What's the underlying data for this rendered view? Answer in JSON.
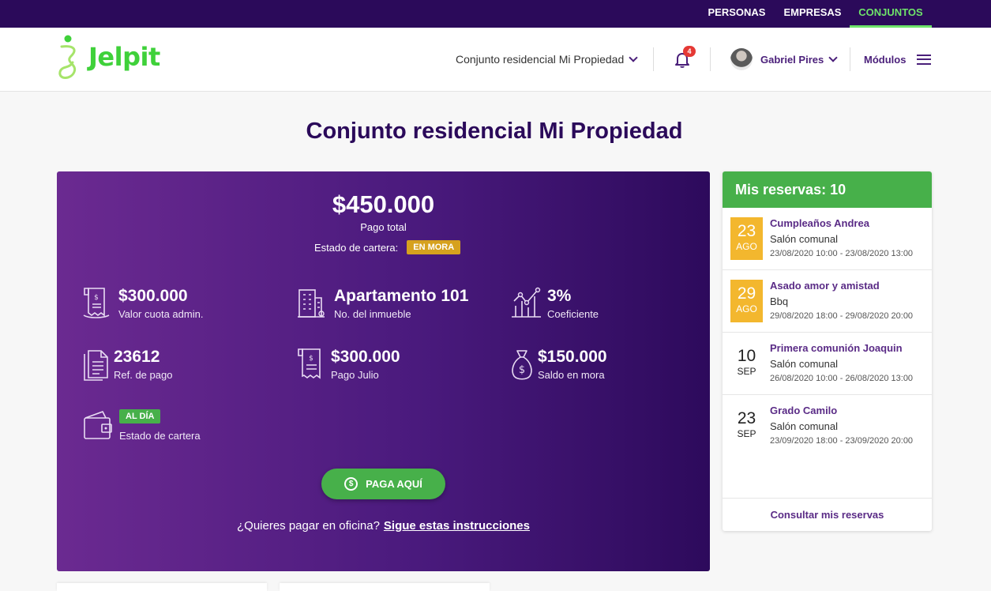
{
  "topbar": {
    "tabs": [
      "PERSONAS",
      "EMPRESAS",
      "CONJUNTOS"
    ],
    "active": "CONJUNTOS"
  },
  "header": {
    "logo_text": "Jelpit",
    "property_selector": "Conjunto residencial Mi Propiedad",
    "notifications_count": "4",
    "user_name": "Gabriel Pires",
    "modules_label": "Módulos"
  },
  "page_title": "Conjunto residencial Mi Propiedad",
  "summary": {
    "total": "$450.000",
    "total_label": "Pago total",
    "estado_label": "Estado de cartera:",
    "estado_badge": "EN MORA",
    "stats": {
      "cuota": {
        "value": "$300.000",
        "label": "Valor cuota admin."
      },
      "inmueble": {
        "value": "Apartamento 101",
        "label": "No. del inmueble"
      },
      "coeficiente": {
        "value": "3%",
        "label": "Coeficiente"
      },
      "ref": {
        "value": "23612",
        "label": "Ref. de pago"
      },
      "pago_mes": {
        "value": "$300.000",
        "label": "Pago Julio"
      },
      "saldo_mora": {
        "value": "$150.000",
        "label": "Saldo en mora"
      },
      "estado_cartera": {
        "badge": "AL DÍA",
        "label": "Estado de cartera"
      }
    },
    "pay_button": "PAGA AQUÍ",
    "office_question": "¿Quieres pagar en oficina?",
    "office_link": "Sigue estas instrucciones"
  },
  "reservations": {
    "title": "Mis reservas: 10",
    "items": [
      {
        "day": "23",
        "month": "AGO",
        "title": "Cumpleaños Andrea",
        "place": "Salón comunal",
        "time": "23/08/2020 10:00 - 23/08/2020 13:00",
        "highlight": true
      },
      {
        "day": "29",
        "month": "AGO",
        "title": "Asado amor y amistad",
        "place": "Bbq",
        "time": "29/08/2020 18:00 - 29/08/2020 20:00",
        "highlight": true
      },
      {
        "day": "10",
        "month": "SEP",
        "title": "Primera comunión Joaquin",
        "place": "Salón comunal",
        "time": "26/08/2020 10:00 - 26/08/2020 13:00",
        "highlight": false
      },
      {
        "day": "23",
        "month": "SEP",
        "title": "Grado Camilo",
        "place": "Salón comunal",
        "time": "23/09/2020 18:00 - 23/09/2020 20:00",
        "highlight": false
      }
    ],
    "footer_link": "Consultar mis reservas"
  },
  "colors": {
    "brand_purple": "#2b0a5a",
    "accent_green": "#47b04a",
    "warning": "#d6a11e",
    "date_highlight": "#f3b72e"
  }
}
